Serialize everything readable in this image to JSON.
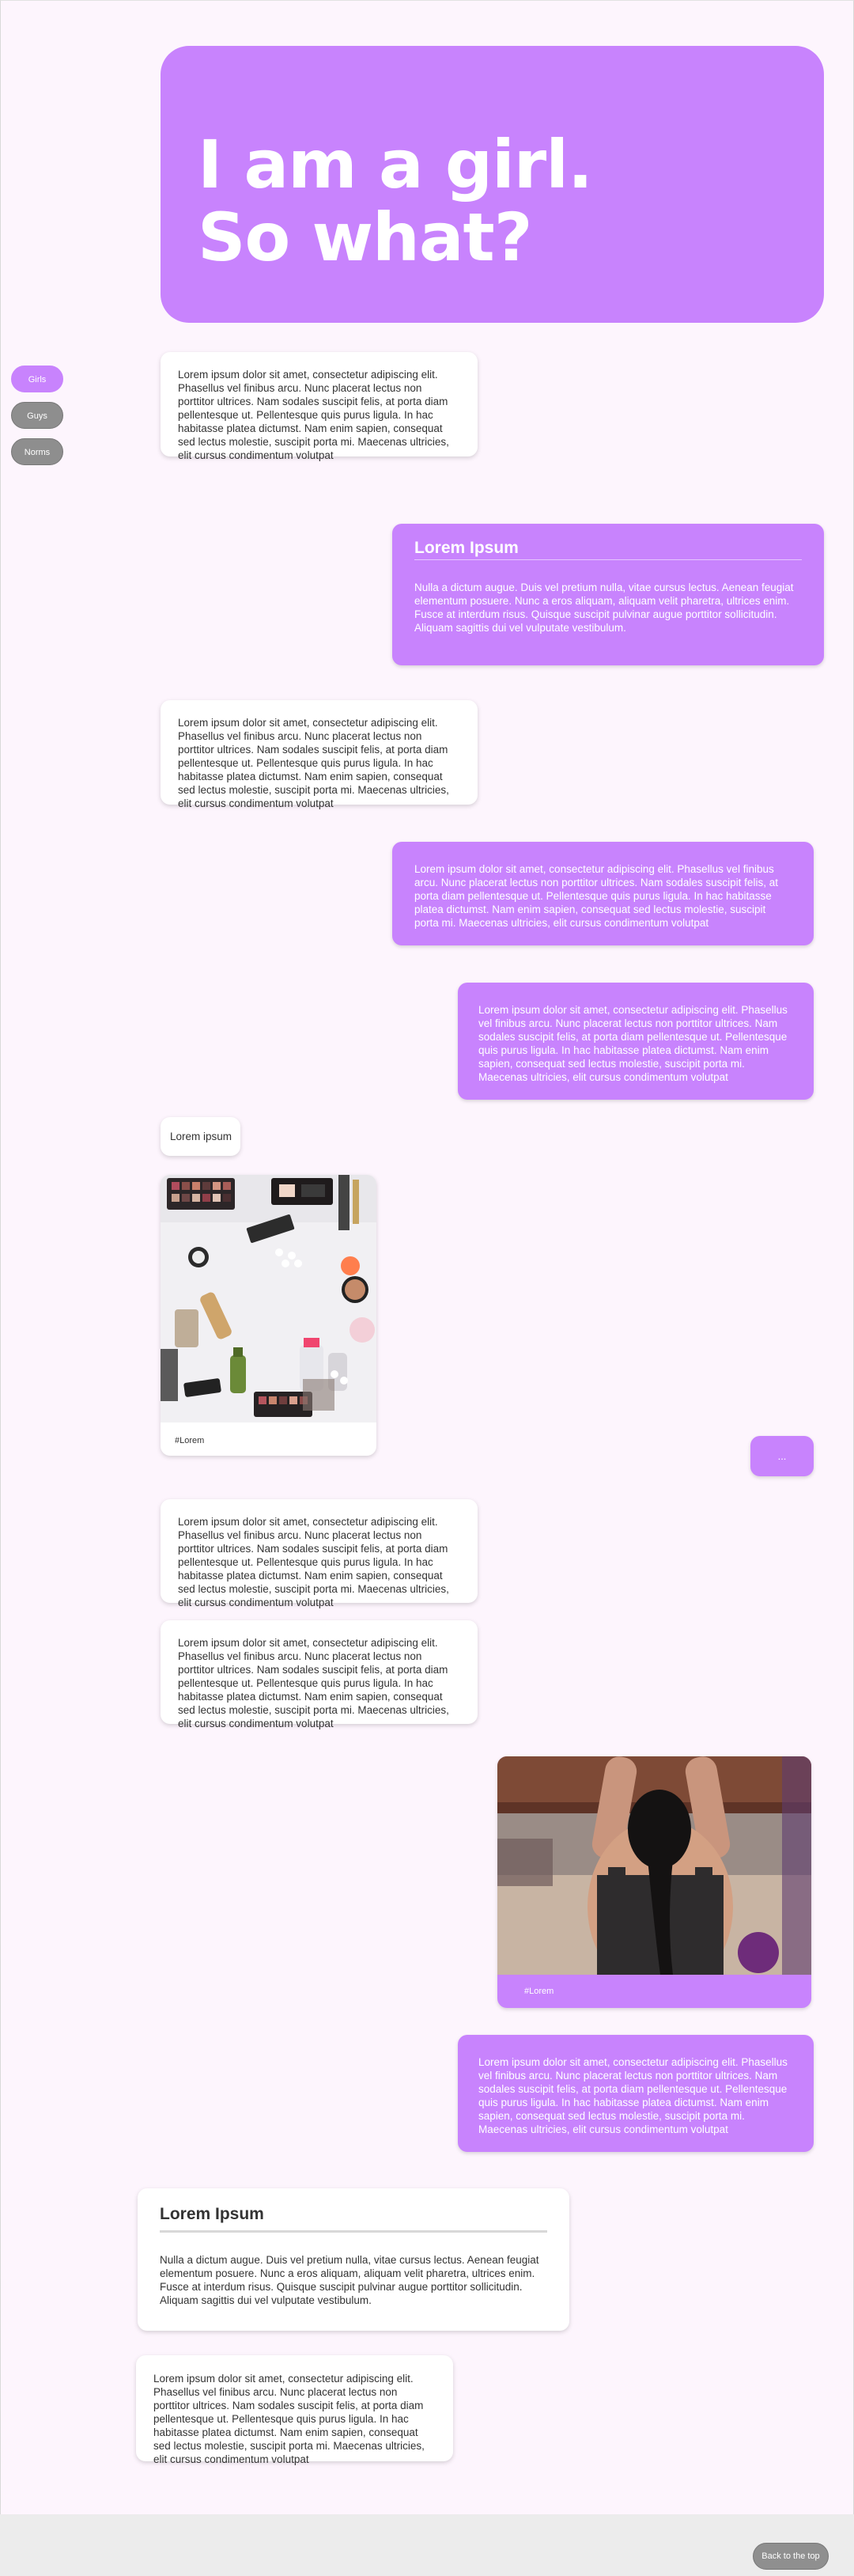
{
  "hero": {
    "line1": "I am a girl.",
    "line2": "So what?"
  },
  "nav": {
    "items": [
      {
        "label": "Girls"
      },
      {
        "label": "Guys"
      },
      {
        "label": "Norms"
      }
    ]
  },
  "messages": {
    "m1": "Lorem ipsum dolor sit amet, consectetur adipiscing elit. Phasellus vel finibus arcu. Nunc placerat lectus non porttitor ultrices. Nam sodales suscipit felis, at porta diam pellentesque ut. Pellentesque quis purus ligula. In hac habitasse platea dictumst. Nam enim sapien, consequat sed lectus molestie, suscipit porta mi. Maecenas ultricies, elit cursus condimentum volutpat",
    "m2_title": "Lorem Ipsum",
    "m2_body": "Nulla a dictum augue. Duis vel pretium nulla, vitae cursus lectus. Aenean feugiat elementum posuere. Nunc a eros aliquam, aliquam velit pharetra, ultrices enim. Fusce at interdum risus. Quisque suscipit pulvinar augue porttitor sollicitudin. Aliquam sagittis dui vel vulputate vestibulum.",
    "m3": "Lorem ipsum dolor sit amet, consectetur adipiscing elit. Phasellus vel finibus arcu. Nunc placerat lectus non porttitor ultrices. Nam sodales suscipit felis, at porta diam pellentesque ut. Pellentesque quis purus ligula. In hac habitasse platea dictumst. Nam enim sapien, consequat sed lectus molestie, suscipit porta mi. Maecenas ultricies, elit cursus condimentum volutpat",
    "m4": "Lorem ipsum dolor sit amet, consectetur adipiscing elit. Phasellus vel finibus arcu. Nunc placerat lectus non porttitor ultrices. Nam sodales suscipit felis, at porta diam pellentesque ut. Pellentesque quis purus ligula. In hac habitasse platea dictumst. Nam enim sapien, consequat sed lectus molestie, suscipit porta mi. Maecenas ultricies, elit cursus condimentum volutpat",
    "m5": "Lorem ipsum dolor sit amet, consectetur adipiscing elit. Phasellus vel finibus arcu. Nunc placerat lectus non porttitor ultrices. Nam sodales suscipit felis, at porta diam pellentesque ut. Pellentesque quis purus ligula. In hac habitasse platea dictumst. Nam enim sapien, consequat sed lectus molestie, suscipit porta mi. Maecenas ultricies, elit cursus condimentum volutpat",
    "m6": "Lorem ipsum",
    "m7_caption": "#Lorem",
    "m8": "...",
    "m9": "Lorem ipsum dolor sit amet, consectetur adipiscing elit. Phasellus vel finibus arcu. Nunc placerat lectus non porttitor ultrices. Nam sodales suscipit felis, at porta diam pellentesque ut. Pellentesque quis purus ligula. In hac habitasse platea dictumst. Nam enim sapien, consequat sed lectus molestie, suscipit porta mi. Maecenas ultricies, elit cursus condimentum volutpat",
    "m10": "Lorem ipsum dolor sit amet, consectetur adipiscing elit. Phasellus vel finibus arcu. Nunc placerat lectus non porttitor ultrices. Nam sodales suscipit felis, at porta diam pellentesque ut. Pellentesque quis purus ligula. In hac habitasse platea dictumst. Nam enim sapien, consequat sed lectus molestie, suscipit porta mi. Maecenas ultricies, elit cursus condimentum volutpat",
    "m11_caption": "#Lorem",
    "m12": "Lorem ipsum dolor sit amet, consectetur adipiscing elit. Phasellus vel finibus arcu. Nunc placerat lectus non porttitor ultrices. Nam sodales suscipit felis, at porta diam pellentesque ut. Pellentesque quis purus ligula. In hac habitasse platea dictumst. Nam enim sapien, consequat sed lectus molestie, suscipit porta mi. Maecenas ultricies, elit cursus condimentum volutpat",
    "m13_title": "Lorem Ipsum",
    "m13_body": "Nulla a dictum augue. Duis vel pretium nulla, vitae cursus lectus. Aenean feugiat elementum posuere. Nunc a eros aliquam, aliquam velit pharetra, ultrices enim. Fusce at interdum risus. Quisque suscipit pulvinar augue porttitor sollicitudin. Aliquam sagittis dui vel vulputate vestibulum.",
    "m14": "Lorem ipsum dolor sit amet, consectetur adipiscing elit. Phasellus vel finibus arcu. Nunc placerat lectus non porttitor ultrices. Nam sodales suscipit felis, at porta diam pellentesque ut. Pellentesque quis purus ligula. In hac habitasse platea dictumst. Nam enim sapien, consequat sed lectus molestie, suscipit porta mi. Maecenas ultricies, elit cursus condimentum volutpat"
  },
  "footer": {
    "back_to_top": "Back to the top"
  },
  "colors": {
    "accent": "#c883fd",
    "background": "#fdf5fd",
    "pill_inactive": "#8e8e8e"
  }
}
